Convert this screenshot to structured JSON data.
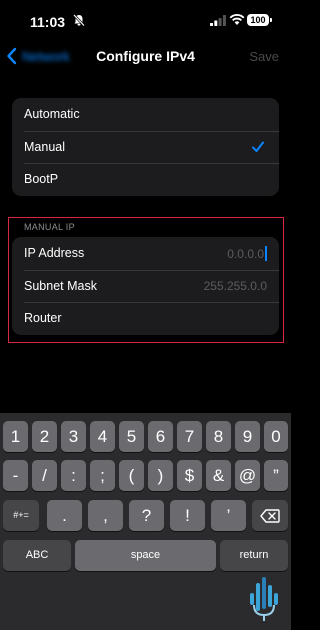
{
  "status_bar": {
    "time": "11:03",
    "battery": "100"
  },
  "nav": {
    "back_label": "Network",
    "title": "Configure IPv4",
    "save_label": "Save"
  },
  "method_options": [
    {
      "label": "Automatic",
      "selected": false
    },
    {
      "label": "Manual",
      "selected": true
    },
    {
      "label": "BootP",
      "selected": false
    }
  ],
  "manual_ip": {
    "header": "MANUAL IP",
    "fields": [
      {
        "label": "IP Address",
        "placeholder": "0.0.0.0"
      },
      {
        "label": "Subnet Mask",
        "placeholder": "255.255.0.0"
      },
      {
        "label": "Router",
        "placeholder": ""
      }
    ]
  },
  "keyboard": {
    "row1": [
      "1",
      "2",
      "3",
      "4",
      "5",
      "6",
      "7",
      "8",
      "9",
      "0"
    ],
    "row2": [
      "-",
      "/",
      ":",
      ";",
      "(",
      ")",
      "$",
      "&",
      "@",
      "”"
    ],
    "row3_toggle": "#+=",
    "row3": [
      ".",
      ",",
      "?",
      "!",
      "’"
    ],
    "abc": "ABC",
    "space": "space",
    "return": "return"
  },
  "colors": {
    "accent": "#0a84ff",
    "highlight_border": "#d7263d",
    "cell_bg": "#1c1c1e",
    "keyboard_bg": "#2b2b2d"
  }
}
